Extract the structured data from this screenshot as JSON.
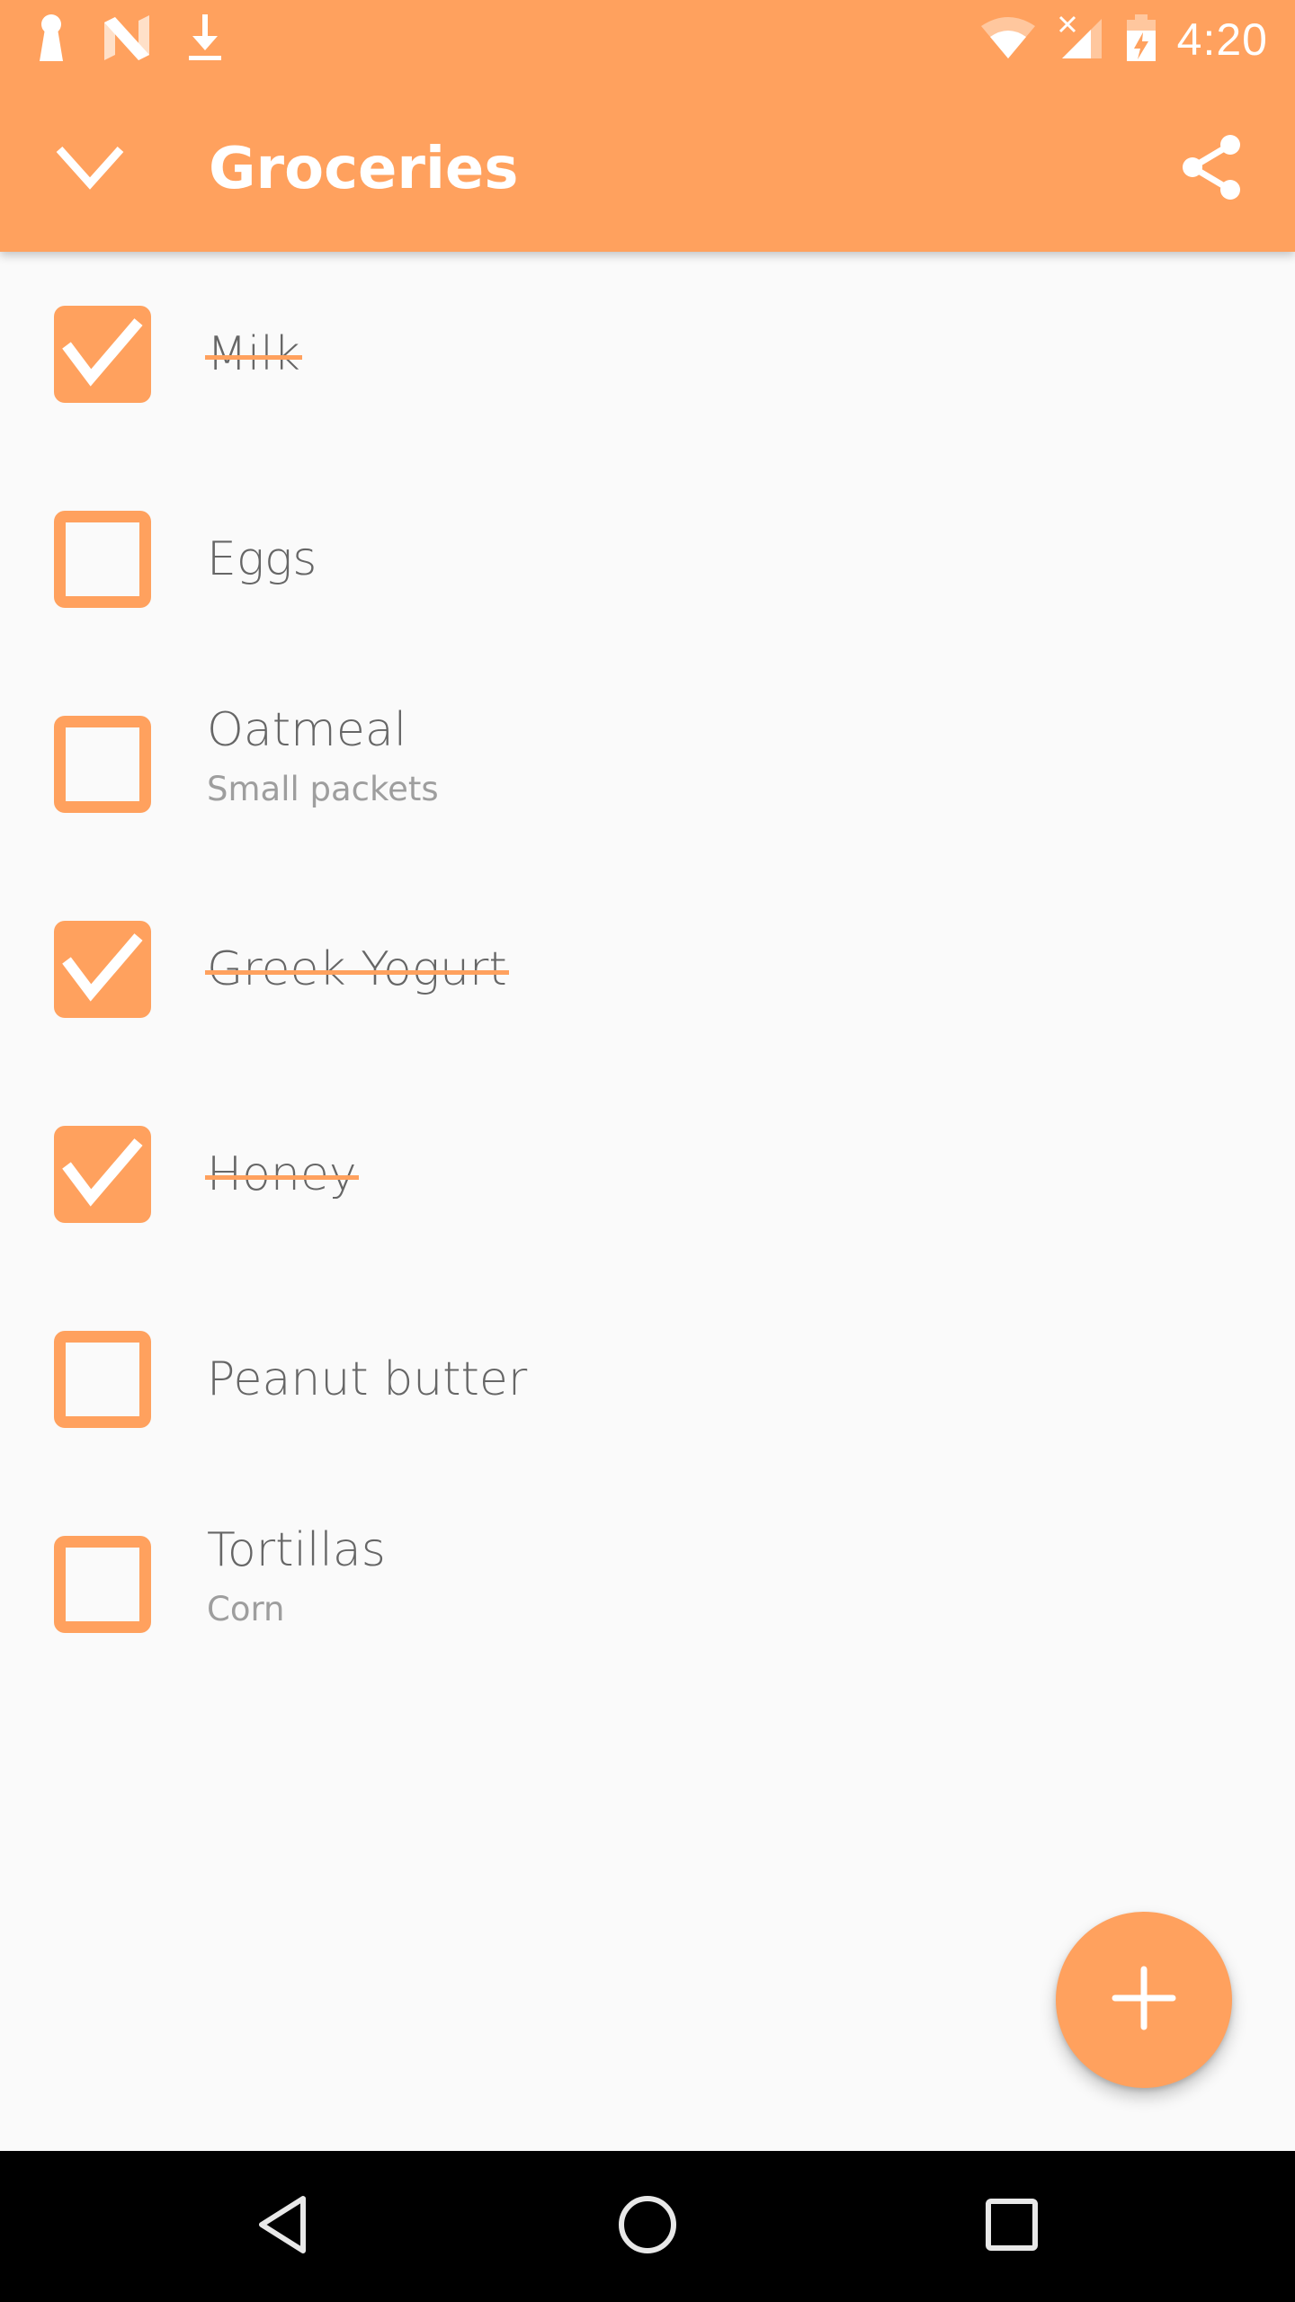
{
  "status_bar": {
    "left_icons": [
      "keyhole-icon",
      "n-logo-icon",
      "download-icon"
    ],
    "right_icons": [
      "wifi-icon",
      "signal-no-data-icon",
      "battery-charging-icon"
    ],
    "time": "4:20"
  },
  "app_bar": {
    "title": "Groceries",
    "left_icon": "chevron-down-icon",
    "right_icon": "share-icon",
    "color": "#ffa15e"
  },
  "items": [
    {
      "title": "Milk",
      "subtitle": "",
      "checked": true
    },
    {
      "title": "Eggs",
      "subtitle": "",
      "checked": false
    },
    {
      "title": "Oatmeal",
      "subtitle": "Small packets",
      "checked": false
    },
    {
      "title": "Greek Yogurt",
      "subtitle": "",
      "checked": true
    },
    {
      "title": "Honey",
      "subtitle": "",
      "checked": true
    },
    {
      "title": "Peanut butter",
      "subtitle": "",
      "checked": false
    },
    {
      "title": "Tortillas",
      "subtitle": "Corn",
      "checked": false
    }
  ],
  "fab": {
    "icon": "plus-icon",
    "label": "Add item"
  },
  "nav_bar": {
    "buttons": [
      "back-icon",
      "home-icon",
      "recents-icon"
    ]
  },
  "colors": {
    "accent": "#ffa15e",
    "text_primary": "#666666",
    "text_secondary": "#9e9e9e",
    "background": "#fafafa"
  }
}
